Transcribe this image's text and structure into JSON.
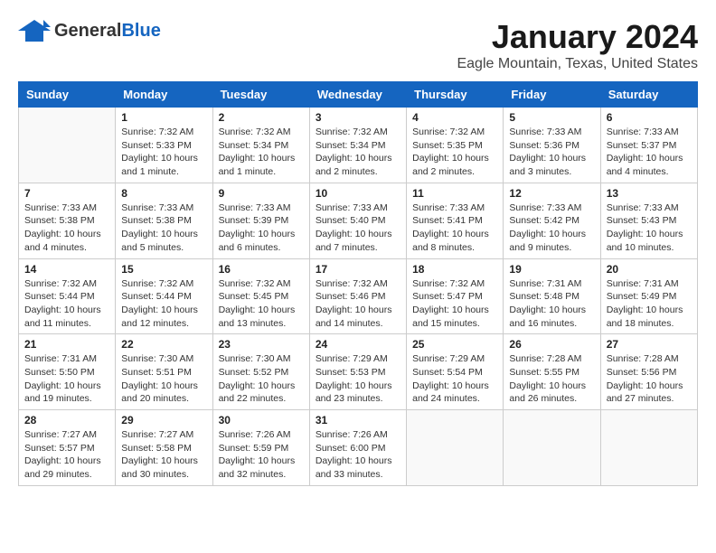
{
  "logo": {
    "general": "General",
    "blue": "Blue"
  },
  "title": "January 2024",
  "subtitle": "Eagle Mountain, Texas, United States",
  "days_of_week": [
    "Sunday",
    "Monday",
    "Tuesday",
    "Wednesday",
    "Thursday",
    "Friday",
    "Saturday"
  ],
  "weeks": [
    [
      {
        "day": "",
        "info": ""
      },
      {
        "day": "1",
        "info": "Sunrise: 7:32 AM\nSunset: 5:33 PM\nDaylight: 10 hours\nand 1 minute."
      },
      {
        "day": "2",
        "info": "Sunrise: 7:32 AM\nSunset: 5:34 PM\nDaylight: 10 hours\nand 1 minute."
      },
      {
        "day": "3",
        "info": "Sunrise: 7:32 AM\nSunset: 5:34 PM\nDaylight: 10 hours\nand 2 minutes."
      },
      {
        "day": "4",
        "info": "Sunrise: 7:32 AM\nSunset: 5:35 PM\nDaylight: 10 hours\nand 2 minutes."
      },
      {
        "day": "5",
        "info": "Sunrise: 7:33 AM\nSunset: 5:36 PM\nDaylight: 10 hours\nand 3 minutes."
      },
      {
        "day": "6",
        "info": "Sunrise: 7:33 AM\nSunset: 5:37 PM\nDaylight: 10 hours\nand 4 minutes."
      }
    ],
    [
      {
        "day": "7",
        "info": "Sunrise: 7:33 AM\nSunset: 5:38 PM\nDaylight: 10 hours\nand 4 minutes."
      },
      {
        "day": "8",
        "info": "Sunrise: 7:33 AM\nSunset: 5:38 PM\nDaylight: 10 hours\nand 5 minutes."
      },
      {
        "day": "9",
        "info": "Sunrise: 7:33 AM\nSunset: 5:39 PM\nDaylight: 10 hours\nand 6 minutes."
      },
      {
        "day": "10",
        "info": "Sunrise: 7:33 AM\nSunset: 5:40 PM\nDaylight: 10 hours\nand 7 minutes."
      },
      {
        "day": "11",
        "info": "Sunrise: 7:33 AM\nSunset: 5:41 PM\nDaylight: 10 hours\nand 8 minutes."
      },
      {
        "day": "12",
        "info": "Sunrise: 7:33 AM\nSunset: 5:42 PM\nDaylight: 10 hours\nand 9 minutes."
      },
      {
        "day": "13",
        "info": "Sunrise: 7:33 AM\nSunset: 5:43 PM\nDaylight: 10 hours\nand 10 minutes."
      }
    ],
    [
      {
        "day": "14",
        "info": "Sunrise: 7:32 AM\nSunset: 5:44 PM\nDaylight: 10 hours\nand 11 minutes."
      },
      {
        "day": "15",
        "info": "Sunrise: 7:32 AM\nSunset: 5:44 PM\nDaylight: 10 hours\nand 12 minutes."
      },
      {
        "day": "16",
        "info": "Sunrise: 7:32 AM\nSunset: 5:45 PM\nDaylight: 10 hours\nand 13 minutes."
      },
      {
        "day": "17",
        "info": "Sunrise: 7:32 AM\nSunset: 5:46 PM\nDaylight: 10 hours\nand 14 minutes."
      },
      {
        "day": "18",
        "info": "Sunrise: 7:32 AM\nSunset: 5:47 PM\nDaylight: 10 hours\nand 15 minutes."
      },
      {
        "day": "19",
        "info": "Sunrise: 7:31 AM\nSunset: 5:48 PM\nDaylight: 10 hours\nand 16 minutes."
      },
      {
        "day": "20",
        "info": "Sunrise: 7:31 AM\nSunset: 5:49 PM\nDaylight: 10 hours\nand 18 minutes."
      }
    ],
    [
      {
        "day": "21",
        "info": "Sunrise: 7:31 AM\nSunset: 5:50 PM\nDaylight: 10 hours\nand 19 minutes."
      },
      {
        "day": "22",
        "info": "Sunrise: 7:30 AM\nSunset: 5:51 PM\nDaylight: 10 hours\nand 20 minutes."
      },
      {
        "day": "23",
        "info": "Sunrise: 7:30 AM\nSunset: 5:52 PM\nDaylight: 10 hours\nand 22 minutes."
      },
      {
        "day": "24",
        "info": "Sunrise: 7:29 AM\nSunset: 5:53 PM\nDaylight: 10 hours\nand 23 minutes."
      },
      {
        "day": "25",
        "info": "Sunrise: 7:29 AM\nSunset: 5:54 PM\nDaylight: 10 hours\nand 24 minutes."
      },
      {
        "day": "26",
        "info": "Sunrise: 7:28 AM\nSunset: 5:55 PM\nDaylight: 10 hours\nand 26 minutes."
      },
      {
        "day": "27",
        "info": "Sunrise: 7:28 AM\nSunset: 5:56 PM\nDaylight: 10 hours\nand 27 minutes."
      }
    ],
    [
      {
        "day": "28",
        "info": "Sunrise: 7:27 AM\nSunset: 5:57 PM\nDaylight: 10 hours\nand 29 minutes."
      },
      {
        "day": "29",
        "info": "Sunrise: 7:27 AM\nSunset: 5:58 PM\nDaylight: 10 hours\nand 30 minutes."
      },
      {
        "day": "30",
        "info": "Sunrise: 7:26 AM\nSunset: 5:59 PM\nDaylight: 10 hours\nand 32 minutes."
      },
      {
        "day": "31",
        "info": "Sunrise: 7:26 AM\nSunset: 6:00 PM\nDaylight: 10 hours\nand 33 minutes."
      },
      {
        "day": "",
        "info": ""
      },
      {
        "day": "",
        "info": ""
      },
      {
        "day": "",
        "info": ""
      }
    ]
  ]
}
